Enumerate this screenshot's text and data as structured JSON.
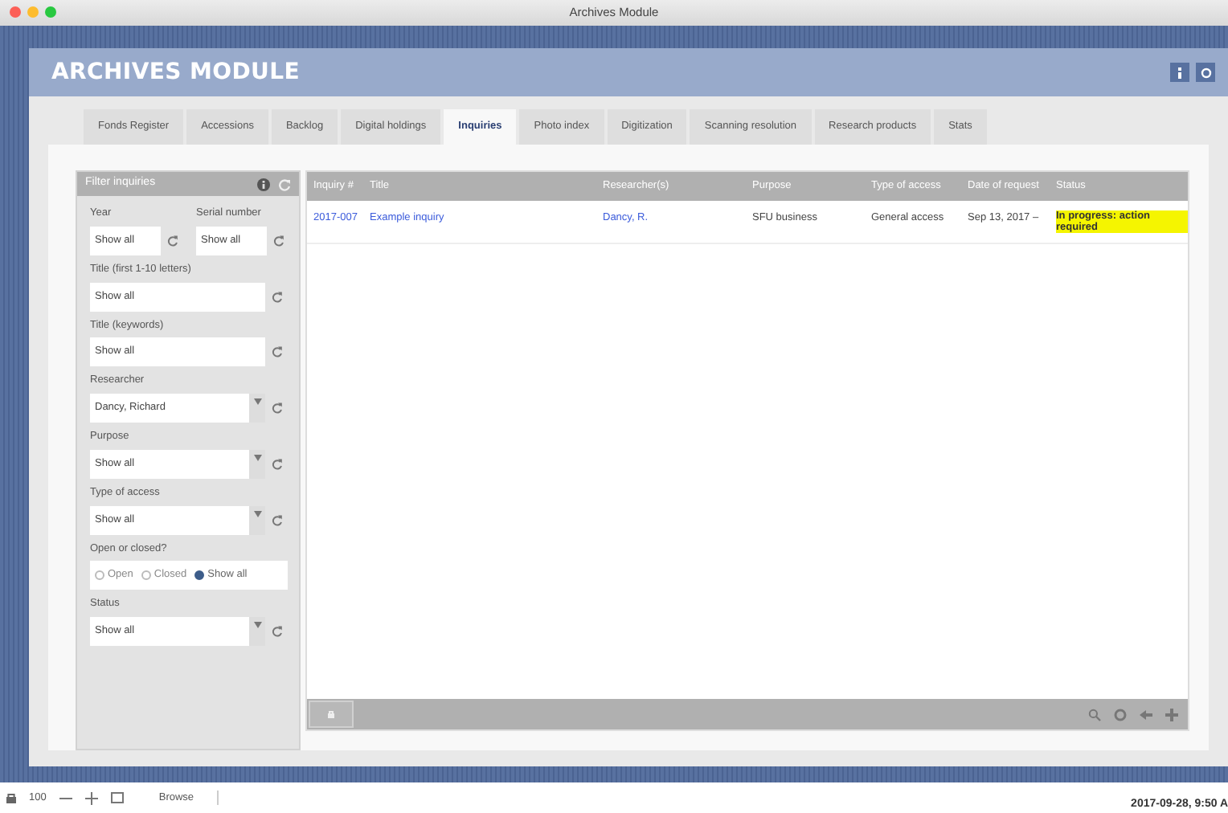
{
  "window": {
    "title": "Archives Module"
  },
  "header": {
    "title": "ARCHIVES MODULE"
  },
  "tabs": [
    {
      "label": "Fonds Register",
      "selected": false
    },
    {
      "label": "Accessions",
      "selected": false
    },
    {
      "label": "Backlog",
      "selected": false
    },
    {
      "label": "Digital holdings",
      "selected": false
    },
    {
      "label": "Inquiries",
      "selected": true
    },
    {
      "label": "Photo index",
      "selected": false
    },
    {
      "label": "Digitization",
      "selected": false
    },
    {
      "label": "Scanning resolution",
      "selected": false
    },
    {
      "label": "Research products",
      "selected": false
    },
    {
      "label": "Stats",
      "selected": false
    }
  ],
  "filter": {
    "title": "Filter inquiries",
    "rows": [
      {
        "kind": "pair",
        "fields": [
          {
            "label": "Year",
            "value": "Show all"
          },
          {
            "label": "Serial number",
            "value": "Show all"
          }
        ]
      },
      {
        "kind": "text",
        "label": "Title (first 1-10 letters)",
        "value": "Show all"
      },
      {
        "kind": "text",
        "label": "Title (keywords)",
        "value": "Show all"
      },
      {
        "kind": "select",
        "label": "Researcher",
        "value": "Dancy, Richard"
      },
      {
        "kind": "select",
        "label": "Purpose",
        "value": "Show all"
      },
      {
        "kind": "select",
        "label": "Type of access",
        "value": "Show all"
      },
      {
        "kind": "radio",
        "label": "Open or closed?",
        "options": [
          {
            "label": "Open",
            "selected": false
          },
          {
            "label": "Closed",
            "selected": false
          },
          {
            "label": "Show all",
            "selected": true
          }
        ]
      },
      {
        "kind": "select",
        "label": "Status",
        "value": "Show all"
      }
    ]
  },
  "table": {
    "columns": [
      {
        "label": "Inquiry #",
        "kind": "link"
      },
      {
        "label": "Title",
        "kind": "link"
      },
      {
        "label": "Researcher(s)",
        "kind": "link"
      },
      {
        "label": "Purpose",
        "kind": "text"
      },
      {
        "label": "Type of access",
        "kind": "text"
      },
      {
        "label": "Date of request",
        "kind": "text"
      },
      {
        "label": "Status",
        "kind": "status"
      }
    ],
    "rows": [
      {
        "cells": [
          "2017-007",
          "Example inquiry",
          "Dancy, R.",
          "SFU business",
          "General access",
          "Sep 13, 2017 –",
          "In progress: action required"
        ]
      }
    ]
  },
  "status_bar": {
    "zoom": "100",
    "mode": "Browse",
    "datetime": "2017-09-28, 9:50 A"
  }
}
